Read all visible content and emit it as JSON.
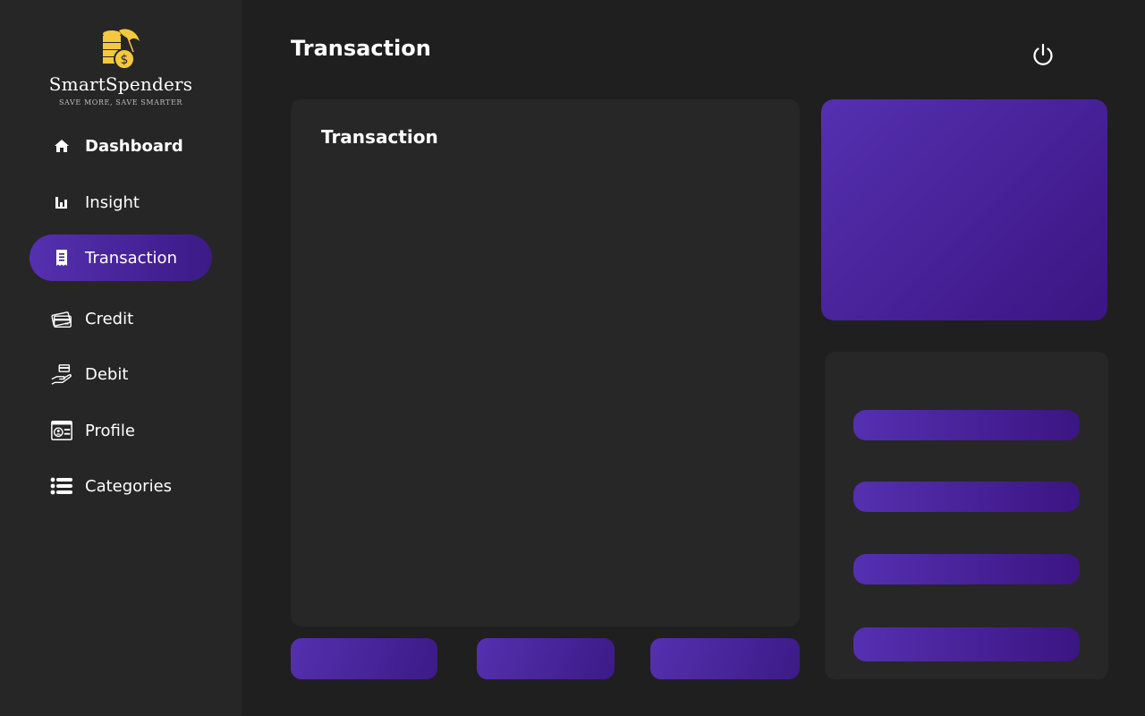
{
  "brand": {
    "name": "SmartSpenders",
    "tagline": "SAVE MORE, SAVE SMARTER",
    "logo_color": "#f5c93f"
  },
  "sidebar": {
    "items": [
      {
        "label": "Dashboard",
        "icon": "home-icon",
        "active": false
      },
      {
        "label": "Insight",
        "icon": "bar-chart-icon",
        "active": false
      },
      {
        "label": "Transaction",
        "icon": "receipt-icon",
        "active": true
      },
      {
        "label": "Credit",
        "icon": "credit-card-icon",
        "active": false
      },
      {
        "label": "Debit",
        "icon": "hand-card-icon",
        "active": false
      },
      {
        "label": "Profile",
        "icon": "id-card-icon",
        "active": false
      },
      {
        "label": "Categories",
        "icon": "list-icon",
        "active": false
      }
    ]
  },
  "header": {
    "title": "Transaction",
    "logout_icon": "power-icon"
  },
  "main": {
    "card_title": "Transaction"
  },
  "colors": {
    "background": "#1f1f1f",
    "sidebar": "#262626",
    "card": "#272727",
    "accent_start": "#5530b0",
    "accent_end": "#3b1582"
  }
}
